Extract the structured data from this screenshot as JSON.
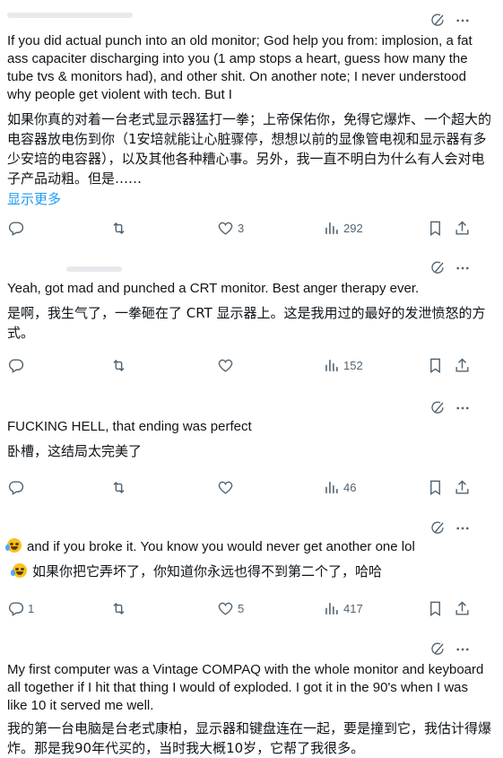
{
  "colors": {
    "text": "#0f1419",
    "muted": "#536471",
    "link": "#1d9bf0",
    "background": "#ffffff"
  },
  "icons": [
    "grok-icon",
    "more-icon",
    "reply-icon",
    "retweet-icon",
    "like-icon",
    "views-icon",
    "bookmark-icon",
    "share-icon",
    "laughing-emoji"
  ],
  "tweets": [
    {
      "en": "If you did actual punch into an old monitor; God help you from: implosion, a fat ass capaciter discharging into you (1 amp stops a heart, guess how many the tube tvs & monitors had), and other shit. On another note; I never understood why people get violent with tech. But I",
      "zh": "如果你真的对着一台老式显示器猛打一拳；上帝保佑你，免得它爆炸、一个超大的电容器放电伤到你（1安培就能让心脏骤停，想想以前的显像管电视和显示器有多少安培的电容器），以及其他各种糟心事。另外，我一直不明白为什么有人会对电子产品动粗。但是……",
      "show_more": "显示更多",
      "stats": {
        "replies": "",
        "retweets": "",
        "likes": "3",
        "views": "292"
      }
    },
    {
      "en": "Yeah, got mad and punched a CRT monitor.  Best anger therapy ever.",
      "zh": "是啊，我生气了，一拳砸在了 CRT 显示器上。这是我用过的最好的发泄愤怒的方式。",
      "stats": {
        "replies": "",
        "retweets": "",
        "likes": "",
        "views": "152"
      }
    },
    {
      "en": "FUCKING HELL, that ending was perfect",
      "zh": "卧槽，这结局太完美了",
      "stats": {
        "replies": "",
        "retweets": "",
        "likes": "",
        "views": "46"
      }
    },
    {
      "en": "and if you broke it. You know you would never get another one lol",
      "zh": "如果你把它弄坏了，你知道你永远也得不到第二个了，哈哈",
      "stats": {
        "replies": "1",
        "retweets": "",
        "likes": "5",
        "views": "417"
      }
    },
    {
      "en": "My first computer was a Vintage COMPAQ with the whole monitor and keyboard all together if I hit that thing I would of exploded. I got it in the 90's when I was like 10 it served me well.",
      "zh": "我的第一台电脑是台老式康柏，显示器和键盘连在一起，要是撞到它，我估计得爆炸。那是我90年代买的，当时我大概10岁，它帮了我很多。"
    }
  ]
}
